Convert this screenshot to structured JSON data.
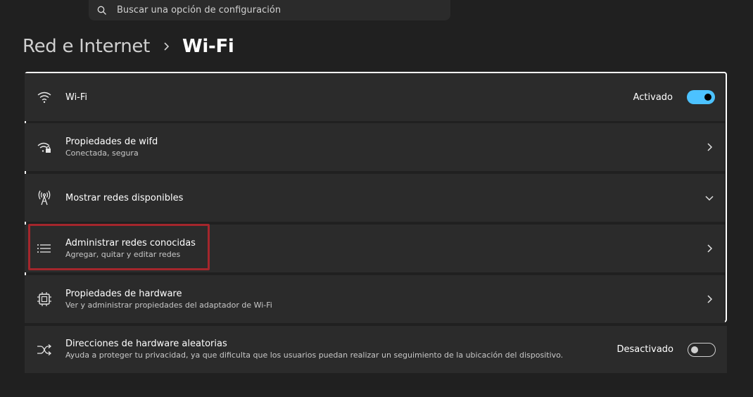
{
  "search": {
    "placeholder": "Buscar una opción de configuración"
  },
  "breadcrumb": {
    "parent": "Red e Internet",
    "current": "Wi-Fi"
  },
  "rows": [
    {
      "icon": "wifi-icon",
      "title": "Wi-Fi",
      "state": "Activado",
      "control": "toggle-on"
    },
    {
      "icon": "wifi-lock-icon",
      "title": "Propiedades de wifd",
      "subtitle": "Conectada, segura",
      "control": "chevron-right"
    },
    {
      "icon": "antenna-icon",
      "title": "Mostrar redes disponibles",
      "control": "chevron-down"
    },
    {
      "icon": "list-icon",
      "title": "Administrar redes conocidas",
      "subtitle": "Agregar, quitar y editar redes",
      "control": "chevron-right"
    },
    {
      "icon": "chip-icon",
      "title": "Propiedades de hardware",
      "subtitle": "Ver y administrar propiedades del adaptador de Wi-Fi",
      "control": "chevron-right"
    }
  ],
  "random_hw": {
    "icon": "shuffle-icon",
    "title": "Direcciones de hardware aleatorias",
    "subtitle": "Ayuda a proteger tu privacidad, ya que dificulta que los usuarios puedan realizar un seguimiento de la ubicación del dispositivo.",
    "state": "Desactivado",
    "control": "toggle-off"
  },
  "colors": {
    "accent": "#4cc2ff",
    "highlight": "#a4262c",
    "background": "#202020",
    "card": "#2b2b2b"
  }
}
